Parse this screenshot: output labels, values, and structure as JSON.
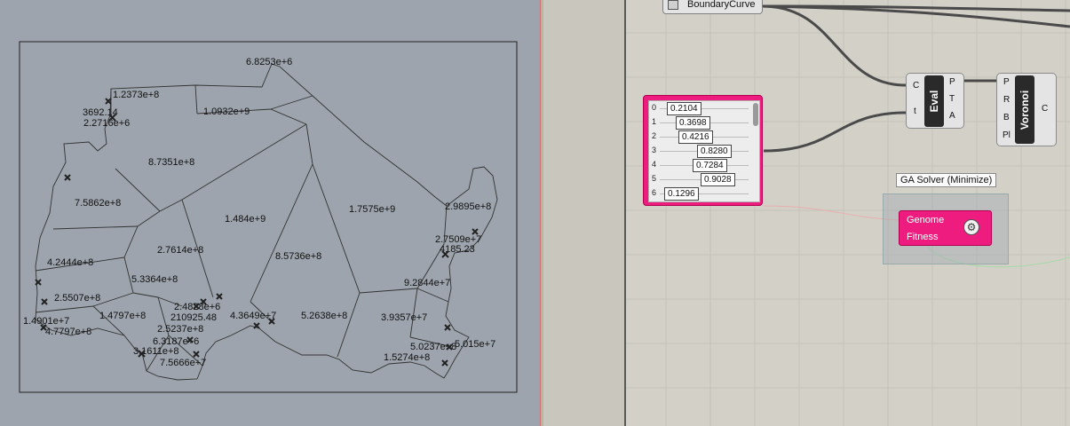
{
  "viewport": {
    "region_labels": [
      "6.8253e+6",
      "1.2373e+8",
      "3692.14",
      "2.2716e+6",
      "1.0932e+9",
      "8.7351e+8",
      "7.5862e+8",
      "1.484e+9",
      "1.7575e+9",
      "2.9895e+8",
      "2.7509e+7",
      "4185.23",
      "4.2444e+8",
      "2.7614e+8",
      "8.5736e+8",
      "5.3364e+8",
      "9.2844e+7",
      "2.5507e+8",
      "2.4828e+6",
      "210925.48",
      "4.3649e+7",
      "4.7797e+8",
      "5.2638e+8",
      "1.4901e+7",
      "1.4797e+8",
      "2.5237e+8",
      "3.9357e+7",
      "6.3187e+6",
      "5.0237e+8",
      "5.015e+7",
      "3.1611e+8",
      "7.5666e+7",
      "1.5274e+8"
    ]
  },
  "canvas": {
    "boundary_param": {
      "label": "BoundaryCurve"
    },
    "eval": {
      "name": "Eval",
      "inputs": [
        "C",
        "t"
      ],
      "outputs": [
        "P",
        "T",
        "A"
      ]
    },
    "voronoi": {
      "name": "Voronoi",
      "inputs": [
        "P",
        "R",
        "B",
        "Pl"
      ],
      "outputs": [
        "C"
      ]
    },
    "slider_list": {
      "items": [
        {
          "index": "0",
          "value": "0.2104",
          "fraction": 0.2104
        },
        {
          "index": "1",
          "value": "0.3698",
          "fraction": 0.3698
        },
        {
          "index": "2",
          "value": "0.4216",
          "fraction": 0.4216
        },
        {
          "index": "3",
          "value": "0.8280",
          "fraction": 0.828
        },
        {
          "index": "4",
          "value": "0.7284",
          "fraction": 0.7284
        },
        {
          "index": "5",
          "value": "0.9028",
          "fraction": 0.9028
        },
        {
          "index": "6",
          "value": "0.1296",
          "fraction": 0.1296
        }
      ]
    },
    "ga_solver": {
      "tooltip": "GA Solver (Minimize)",
      "genome_label": "Genome",
      "fitness_label": "Fitness",
      "icon": "gear-icon"
    },
    "colors": {
      "accent": "#ee1c7f",
      "canvas_bg": "#d3d0c7",
      "viewport_bg": "#9da4ad",
      "wire": "#4a4a4a"
    }
  }
}
